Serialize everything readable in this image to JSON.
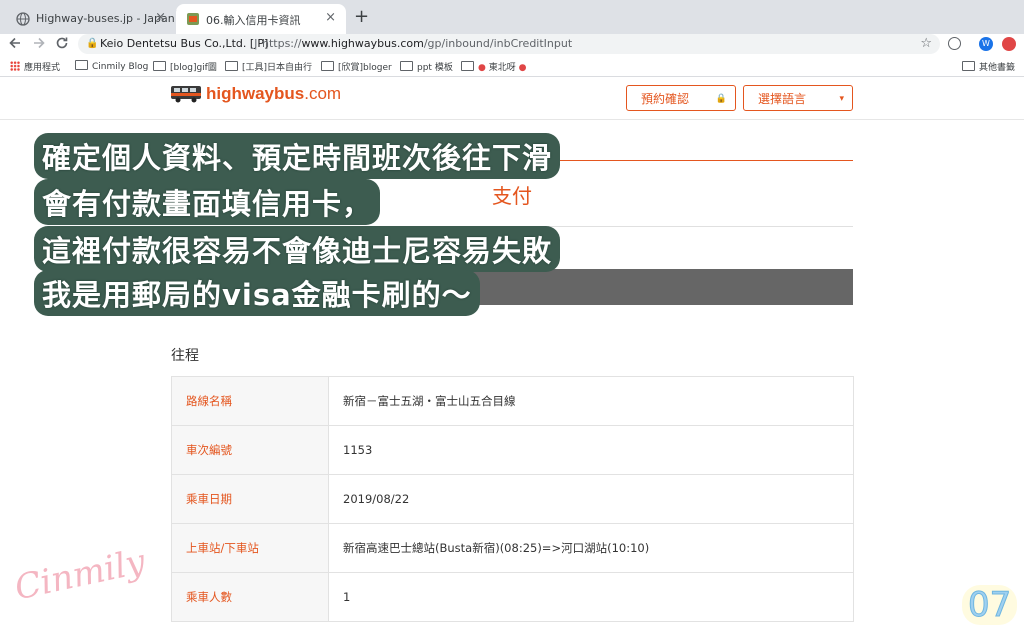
{
  "browser": {
    "tabs": [
      {
        "title": "Highway-buses.jp - Japan",
        "active": false,
        "icon": "globe-icon"
      },
      {
        "title": "06.輸入信用卡資訊",
        "active": true,
        "icon": "site-favicon"
      }
    ],
    "new_tab": "+",
    "close": "×",
    "omnibox": {
      "site_name": "Keio Dentetsu Bus Co.,Ltd. [JP]",
      "url_prefix": "https://",
      "url_domain": "www.highwaybus.com",
      "url_path": "/gp/inbound/inbCreditInput"
    },
    "bookmarks": [
      "應用程式",
      "Cinmily Blog",
      "[blog]gif圖",
      "[工具]日本自由行",
      "[欣賞]bloger",
      "ppt 模板",
      "東北呀",
      "其他書籤"
    ],
    "extension_w": "W"
  },
  "header": {
    "logo": {
      "name": "highwaybus",
      "tld": ".com"
    },
    "reservation_button": "預約確認",
    "language_button": "選擇語言",
    "lock_glyph": "🔒",
    "caret_glyph": "▾",
    "dot_glyph": "●"
  },
  "main": {
    "payment_title": "支付",
    "section_title": "往程",
    "rows": [
      {
        "label": "路線名稱",
        "value": "新宿－富士五湖・富士山五合目線"
      },
      {
        "label": "車次編號",
        "value": "1153"
      },
      {
        "label": "乘車日期",
        "value": "2019/08/22"
      },
      {
        "label": "上車站/下車站",
        "value": "新宿高速巴士總站(Busta新宿)(08:25)=>河口湖站(10:10)"
      },
      {
        "label": "乘車人數",
        "value": "1"
      }
    ]
  },
  "overlay": {
    "lines": [
      "確定個人資料、預定時間班次後往下滑",
      "會有付款畫面填信用卡，",
      "這裡付款很容易不會像迪士尼容易失敗",
      "我是用郵局的visa金融卡刷的～"
    ],
    "signature": "Cinmily",
    "page_number": "07"
  },
  "colors": {
    "brand_orange": "#e4561f",
    "overlay_green": "#3d5c50",
    "dark_bar": "#666666"
  }
}
